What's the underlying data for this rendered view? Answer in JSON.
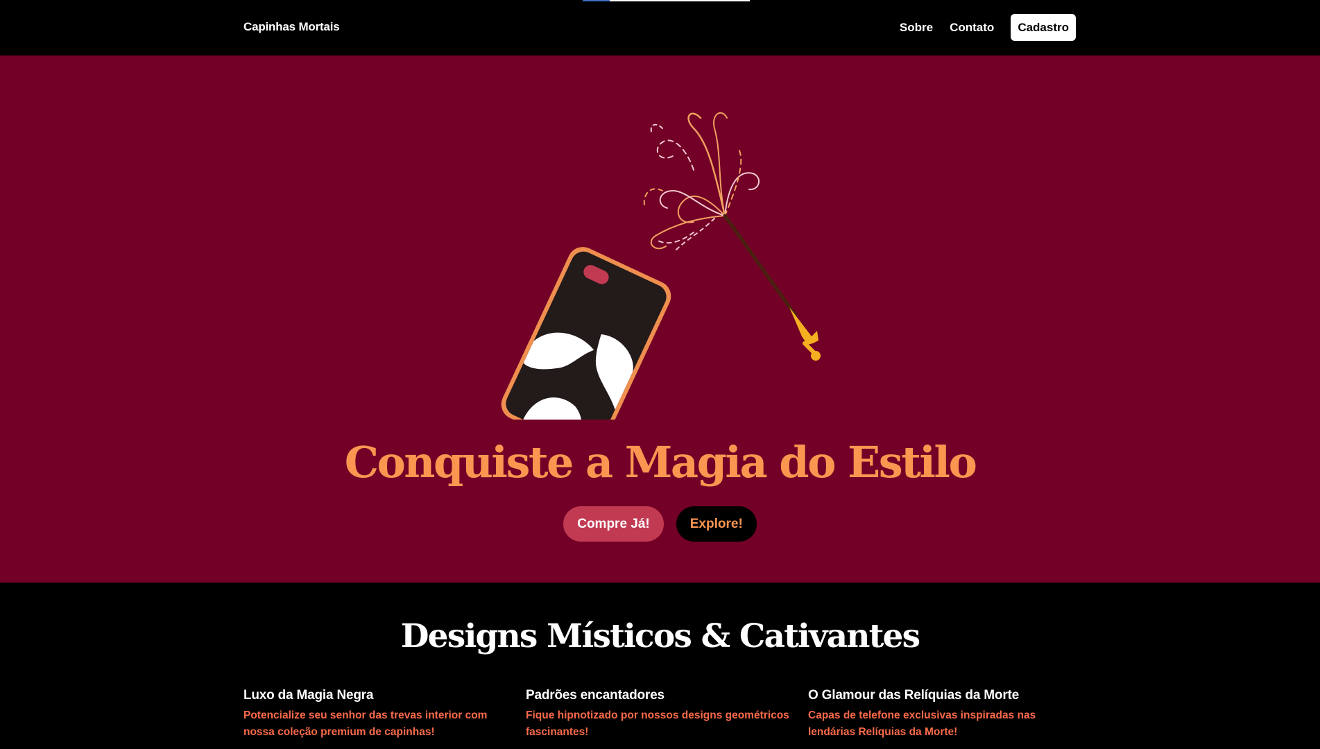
{
  "header": {
    "brand": "Capinhas Mortais",
    "nav": [
      {
        "label": "Sobre"
      },
      {
        "label": "Contato"
      }
    ],
    "cta": "Cadastro",
    "scroll_progress": 0.16
  },
  "hero": {
    "title": "Conquiste a Magia do Estilo",
    "buttons": {
      "primary": "Compre Já!",
      "secondary": "Explore!"
    },
    "illustration_icon": "phone-case-with-magic-wand-illustration"
  },
  "features": {
    "title": "Designs Místicos & Cativantes",
    "items": [
      {
        "title": "Luxo da Magia Negra",
        "description": "Potencialize seu senhor das trevas interior com nossa coleção premium de capinhas!"
      },
      {
        "title": "Padrões encantadores",
        "description": "Fique hipnotizado por nossos designs geométricos fascinantes!"
      },
      {
        "title": "O Glamour das Relíquias da Morte",
        "description": "Capas de telefone exclusivas inspiradas nas lendárias Relíquias da Morte!"
      }
    ]
  },
  "colors": {
    "hero_bg": "#730026",
    "accent_orange": "#fb9651",
    "accent_red": "#fb6a4a",
    "button_primary": "#c23a52",
    "page_bg": "#000000"
  }
}
